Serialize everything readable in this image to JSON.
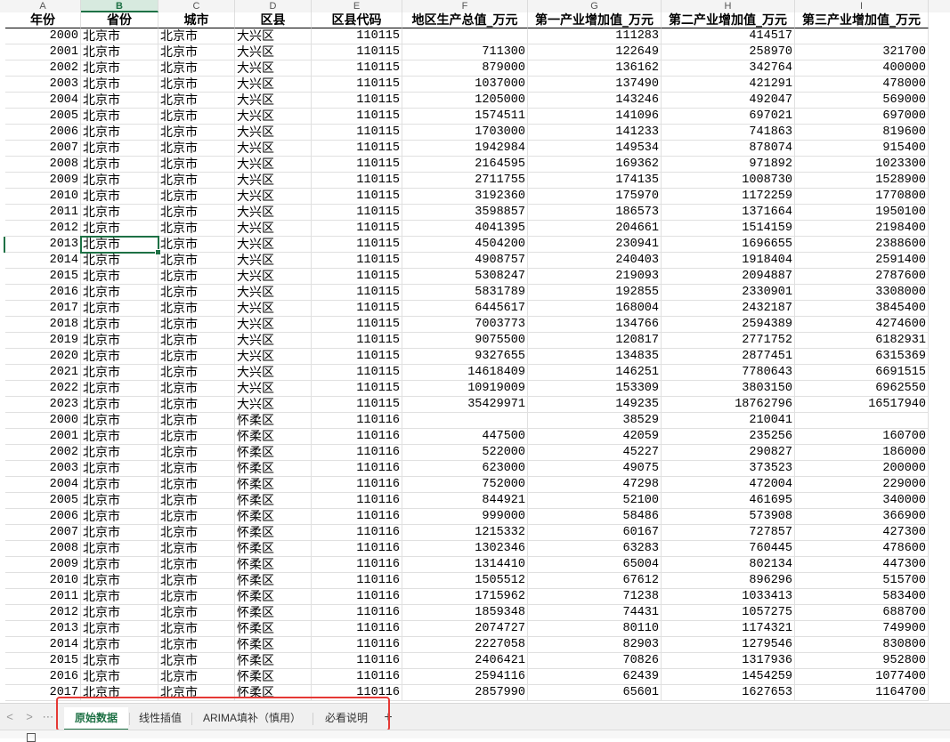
{
  "columns": [
    {
      "letter": "A",
      "selected": false
    },
    {
      "letter": "B",
      "selected": true
    },
    {
      "letter": "C",
      "selected": false
    },
    {
      "letter": "D",
      "selected": false
    },
    {
      "letter": "E",
      "selected": false
    },
    {
      "letter": "F",
      "selected": false
    },
    {
      "letter": "G",
      "selected": false
    },
    {
      "letter": "H",
      "selected": false
    },
    {
      "letter": "I",
      "selected": false
    }
  ],
  "headers": [
    "年份",
    "省份",
    "城市",
    "区县",
    "区县代码",
    "地区生产总值_万元",
    "第一产业增加值_万元",
    "第二产业增加值_万元",
    "第三产业增加值_万元"
  ],
  "rows": [
    [
      "2000",
      "北京市",
      "北京市",
      "大兴区",
      "110115",
      "",
      "111283",
      "414517",
      ""
    ],
    [
      "2001",
      "北京市",
      "北京市",
      "大兴区",
      "110115",
      "711300",
      "122649",
      "258970",
      "321700"
    ],
    [
      "2002",
      "北京市",
      "北京市",
      "大兴区",
      "110115",
      "879000",
      "136162",
      "342764",
      "400000"
    ],
    [
      "2003",
      "北京市",
      "北京市",
      "大兴区",
      "110115",
      "1037000",
      "137490",
      "421291",
      "478000"
    ],
    [
      "2004",
      "北京市",
      "北京市",
      "大兴区",
      "110115",
      "1205000",
      "143246",
      "492047",
      "569000"
    ],
    [
      "2005",
      "北京市",
      "北京市",
      "大兴区",
      "110115",
      "1574511",
      "141096",
      "697021",
      "697000"
    ],
    [
      "2006",
      "北京市",
      "北京市",
      "大兴区",
      "110115",
      "1703000",
      "141233",
      "741863",
      "819600"
    ],
    [
      "2007",
      "北京市",
      "北京市",
      "大兴区",
      "110115",
      "1942984",
      "149534",
      "878074",
      "915400"
    ],
    [
      "2008",
      "北京市",
      "北京市",
      "大兴区",
      "110115",
      "2164595",
      "169362",
      "971892",
      "1023300"
    ],
    [
      "2009",
      "北京市",
      "北京市",
      "大兴区",
      "110115",
      "2711755",
      "174135",
      "1008730",
      "1528900"
    ],
    [
      "2010",
      "北京市",
      "北京市",
      "大兴区",
      "110115",
      "3192360",
      "175970",
      "1172259",
      "1770800"
    ],
    [
      "2011",
      "北京市",
      "北京市",
      "大兴区",
      "110115",
      "3598857",
      "186573",
      "1371664",
      "1950100"
    ],
    [
      "2012",
      "北京市",
      "北京市",
      "大兴区",
      "110115",
      "4041395",
      "204661",
      "1514159",
      "2198400"
    ],
    [
      "2013",
      "北京市",
      "北京市",
      "大兴区",
      "110115",
      "4504200",
      "230941",
      "1696655",
      "2388600"
    ],
    [
      "2014",
      "北京市",
      "北京市",
      "大兴区",
      "110115",
      "4908757",
      "240403",
      "1918404",
      "2591400"
    ],
    [
      "2015",
      "北京市",
      "北京市",
      "大兴区",
      "110115",
      "5308247",
      "219093",
      "2094887",
      "2787600"
    ],
    [
      "2016",
      "北京市",
      "北京市",
      "大兴区",
      "110115",
      "5831789",
      "192855",
      "2330901",
      "3308000"
    ],
    [
      "2017",
      "北京市",
      "北京市",
      "大兴区",
      "110115",
      "6445617",
      "168004",
      "2432187",
      "3845400"
    ],
    [
      "2018",
      "北京市",
      "北京市",
      "大兴区",
      "110115",
      "7003773",
      "134766",
      "2594389",
      "4274600"
    ],
    [
      "2019",
      "北京市",
      "北京市",
      "大兴区",
      "110115",
      "9075500",
      "120817",
      "2771752",
      "6182931"
    ],
    [
      "2020",
      "北京市",
      "北京市",
      "大兴区",
      "110115",
      "9327655",
      "134835",
      "2877451",
      "6315369"
    ],
    [
      "2021",
      "北京市",
      "北京市",
      "大兴区",
      "110115",
      "14618409",
      "146251",
      "7780643",
      "6691515"
    ],
    [
      "2022",
      "北京市",
      "北京市",
      "大兴区",
      "110115",
      "10919009",
      "153309",
      "3803150",
      "6962550"
    ],
    [
      "2023",
      "北京市",
      "北京市",
      "大兴区",
      "110115",
      "35429971",
      "149235",
      "18762796",
      "16517940"
    ],
    [
      "2000",
      "北京市",
      "北京市",
      "怀柔区",
      "110116",
      "",
      "38529",
      "210041",
      ""
    ],
    [
      "2001",
      "北京市",
      "北京市",
      "怀柔区",
      "110116",
      "447500",
      "42059",
      "235256",
      "160700"
    ],
    [
      "2002",
      "北京市",
      "北京市",
      "怀柔区",
      "110116",
      "522000",
      "45227",
      "290827",
      "186000"
    ],
    [
      "2003",
      "北京市",
      "北京市",
      "怀柔区",
      "110116",
      "623000",
      "49075",
      "373523",
      "200000"
    ],
    [
      "2004",
      "北京市",
      "北京市",
      "怀柔区",
      "110116",
      "752000",
      "47298",
      "472004",
      "229000"
    ],
    [
      "2005",
      "北京市",
      "北京市",
      "怀柔区",
      "110116",
      "844921",
      "52100",
      "461695",
      "340000"
    ],
    [
      "2006",
      "北京市",
      "北京市",
      "怀柔区",
      "110116",
      "999000",
      "58486",
      "573908",
      "366900"
    ],
    [
      "2007",
      "北京市",
      "北京市",
      "怀柔区",
      "110116",
      "1215332",
      "60167",
      "727857",
      "427300"
    ],
    [
      "2008",
      "北京市",
      "北京市",
      "怀柔区",
      "110116",
      "1302346",
      "63283",
      "760445",
      "478600"
    ],
    [
      "2009",
      "北京市",
      "北京市",
      "怀柔区",
      "110116",
      "1314410",
      "65004",
      "802134",
      "447300"
    ],
    [
      "2010",
      "北京市",
      "北京市",
      "怀柔区",
      "110116",
      "1505512",
      "67612",
      "896296",
      "515700"
    ],
    [
      "2011",
      "北京市",
      "北京市",
      "怀柔区",
      "110116",
      "1715962",
      "71238",
      "1033413",
      "583400"
    ],
    [
      "2012",
      "北京市",
      "北京市",
      "怀柔区",
      "110116",
      "1859348",
      "74431",
      "1057275",
      "688700"
    ],
    [
      "2013",
      "北京市",
      "北京市",
      "怀柔区",
      "110116",
      "2074727",
      "80110",
      "1174321",
      "749900"
    ],
    [
      "2014",
      "北京市",
      "北京市",
      "怀柔区",
      "110116",
      "2227058",
      "82903",
      "1279546",
      "830800"
    ],
    [
      "2015",
      "北京市",
      "北京市",
      "怀柔区",
      "110116",
      "2406421",
      "70826",
      "1317936",
      "952800"
    ],
    [
      "2016",
      "北京市",
      "北京市",
      "怀柔区",
      "110116",
      "2594116",
      "62439",
      "1454259",
      "1077400"
    ],
    [
      "2017",
      "北京市",
      "北京市",
      "怀柔区",
      "110116",
      "2857990",
      "65601",
      "1627653",
      "1164700"
    ]
  ],
  "active_cell": {
    "row": 13,
    "col": 1,
    "value": "北京市"
  },
  "nav": {
    "prev": "<",
    "next": ">",
    "more": "⋯"
  },
  "tabs": [
    {
      "label": "原始数据",
      "active": true
    },
    {
      "label": "线性插值",
      "active": false
    },
    {
      "label": "ARIMA填补（慎用）",
      "active": false
    },
    {
      "label": "必看说明",
      "active": false
    }
  ],
  "add_tab": "+",
  "colors": {
    "accent": "#1e7145",
    "highlight_box": "#e53935"
  }
}
